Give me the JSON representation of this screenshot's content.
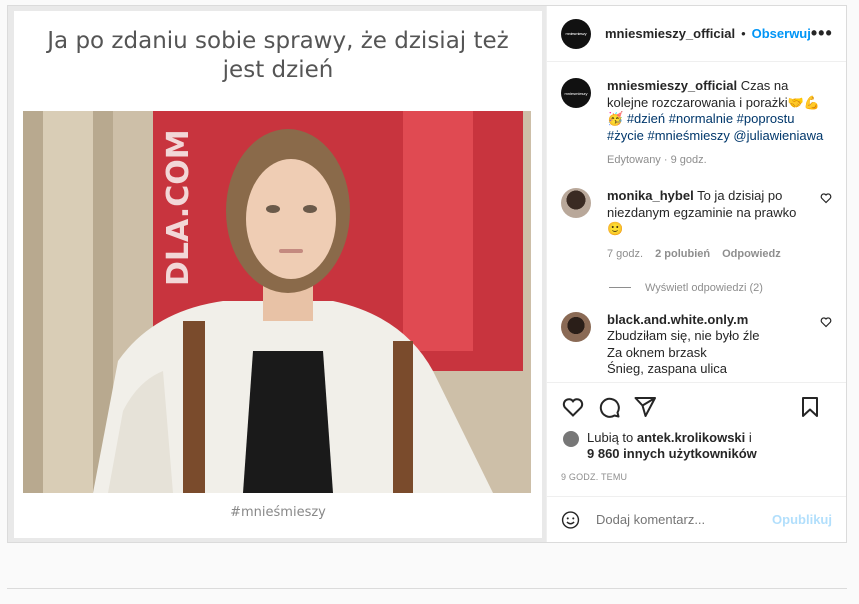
{
  "meme": {
    "caption": "Ja po zdaniu sobie sprawy, że dzisiaj też jest dzień",
    "tag": "#mnieśmieszy",
    "photo_bg_text": "DLA.COM"
  },
  "header": {
    "username": "mniesmieszy_official",
    "dot": "•",
    "follow": "Obserwuj",
    "more": "•••",
    "avatar_text": "mniesmieszy"
  },
  "caption": {
    "username": "mniesmieszy_official",
    "text": "Czas na kolejne rozczarowania i porażki",
    "emojis": "🤝💪🥳",
    "hashtags": "#dzień #normalnie #poprostu #życie #mnieśmieszy @juliawieniawa",
    "meta": "Edytowany · 9 godz."
  },
  "comments": [
    {
      "username": "monika_hybel",
      "text": "To ja dzisiaj po niezdanym egzaminie na prawko 🙂",
      "time": "7 godz.",
      "likes": "2 polubień",
      "reply": "Odpowiedz",
      "view_replies": "Wyświetl odpowiedzi (2)"
    },
    {
      "username": "black.and.white.only.m",
      "text": "Zbudziłam się, nie było źle",
      "line2": "Za oknem brzask",
      "line3": "Śnieg, zaspana ulica"
    }
  ],
  "likes": {
    "prefix": "Lubią to",
    "user": "antek.krolikowski",
    "suffix": "i",
    "others": "9 860 innych użytkowników"
  },
  "time_ago": "9 GODZ. TEMU",
  "add_comment": {
    "placeholder": "Dodaj komentarz...",
    "post_label": "Opublikuj"
  }
}
